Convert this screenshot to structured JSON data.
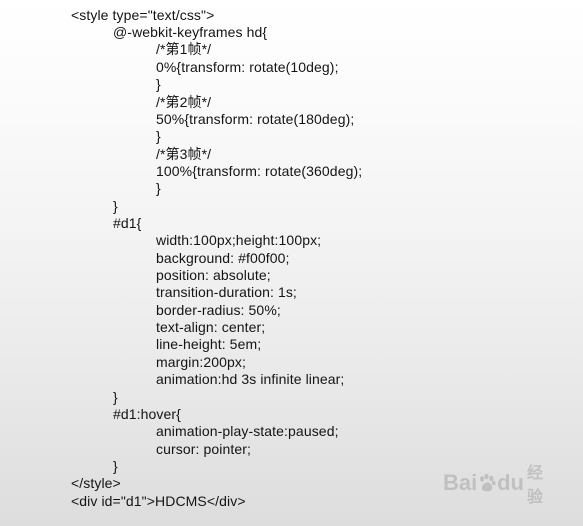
{
  "code_lines": [
    "<style type=\"text/css\">",
    "@-webkit-keyframes hd{",
    "/*第1帧*/",
    "0%{transform: rotate(10deg);",
    "}",
    "/*第2帧*/",
    "50%{transform: rotate(180deg);",
    "}",
    "/*第3帧*/",
    "100%{transform: rotate(360deg);",
    "}",
    "}",
    "#d1{",
    "width:100px;height:100px;",
    "background: #f00f00;",
    "position: absolute;",
    "transition-duration: 1s;",
    "border-radius: 50%;",
    "text-align: center;",
    "line-height: 5em;",
    "margin:200px;",
    "animation:hd 3s infinite linear;",
    "}",
    "#d1:hover{",
    "animation-play-state:paused;",
    "cursor: pointer;",
    "}",
    "</style>",
    "<div id=\"d1\">HDCMS</div>"
  ],
  "watermark": {
    "brand_left": "Bai",
    "brand_right": "du",
    "suffix": "经验",
    "paw_icon": "baidu-paw-icon"
  }
}
